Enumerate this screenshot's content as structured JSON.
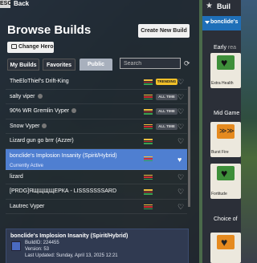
{
  "topbar": {
    "esc_label": "ESC",
    "back_label": "Back"
  },
  "title": "Browse Builds",
  "create_button": "Create New Build",
  "change_hero_button": "Change Hero",
  "tabs": [
    {
      "label": "My Builds"
    },
    {
      "label": "Favorites"
    },
    {
      "label": "Public"
    }
  ],
  "search": {
    "placeholder": "Search",
    "value": ""
  },
  "builds": [
    {
      "name": "TheEloThief's Drift-King",
      "badge": "TRENDING"
    },
    {
      "name": "salty viper",
      "badge": "ALL TIME"
    },
    {
      "name": "90% WR Gremlin Vyper",
      "badge": "ALL TIME"
    },
    {
      "name": "Snow Vyper",
      "badge": "ALL TIME"
    },
    {
      "name": "Lizard gun go brrr (Azzer)",
      "badge": ""
    },
    {
      "name": "bonclide's Implosion Insanity (Spirit/Hybrid)",
      "sub": "Currently Active",
      "badge": ""
    },
    {
      "name": "lizard",
      "badge": ""
    },
    {
      "name": "[PRDG]ЯЩЩЩЩЕРКА - LISSSSSSSARD",
      "badge": ""
    },
    {
      "name": "Lautrec Vyper",
      "badge": ""
    }
  ],
  "detail": {
    "title": "bonclide's Implosion Insanity (Spirit/Hybrid)",
    "build_id": "BuildID: 224455",
    "version": "Version: 53",
    "updated": "Last Updated: Sunday, April 13, 2025 12:21"
  },
  "right_panel": {
    "title": "Buil",
    "header": "bonclide's",
    "early_label": "Early",
    "early_extra": "rea",
    "mid_label": "Mid Game",
    "choice_label": "Choice of",
    "cards": [
      {
        "caption": "Extra Health",
        "color": "#3e8f3a"
      },
      {
        "caption": "Burst Fire",
        "color": "#e58a1f"
      },
      {
        "caption": "Fortitude",
        "color": "#3e8f3a"
      },
      {
        "caption": "",
        "color": "#e58a1f"
      }
    ]
  }
}
